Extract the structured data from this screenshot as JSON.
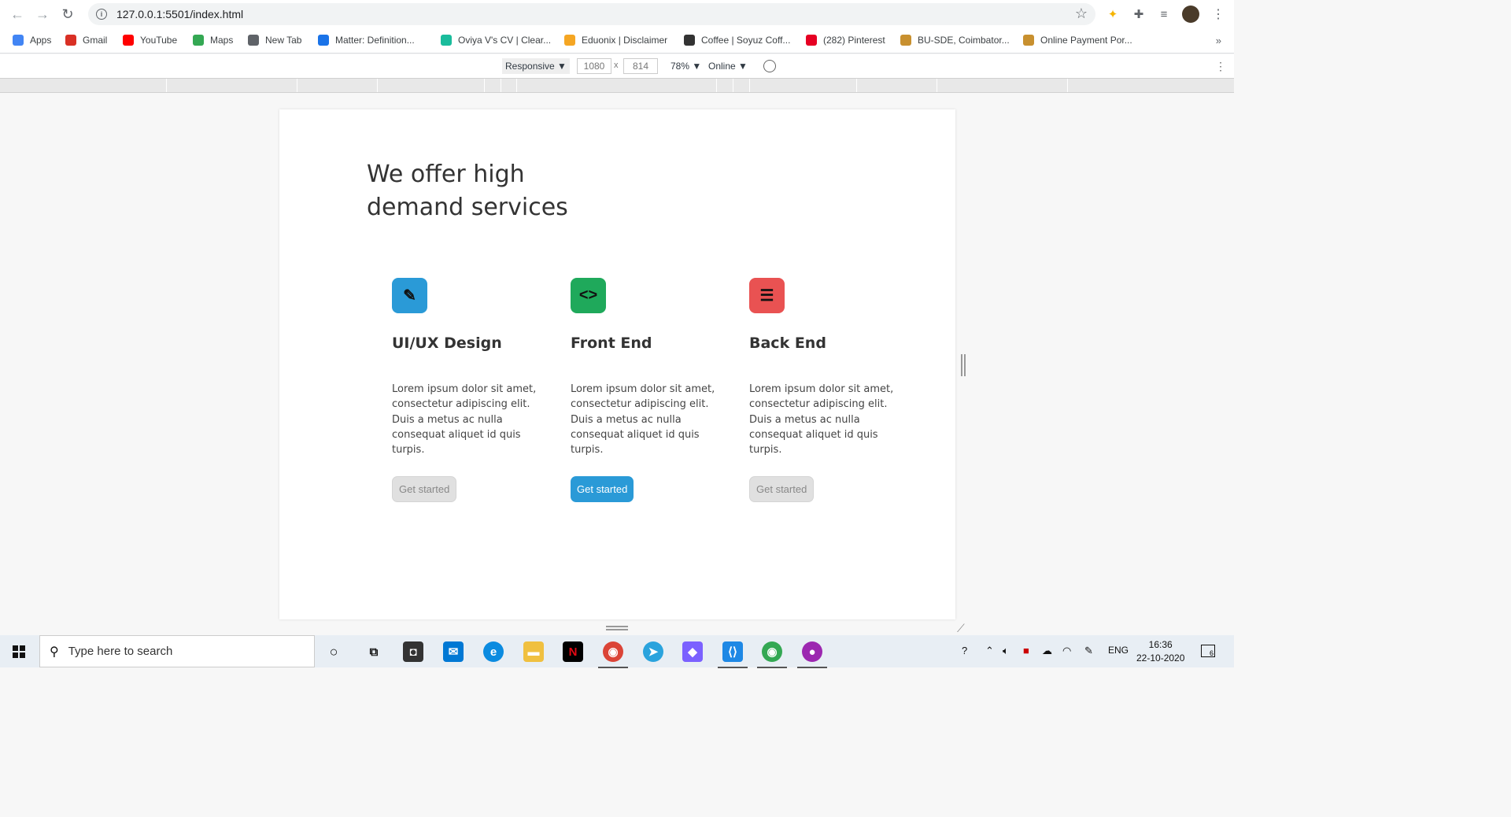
{
  "browser": {
    "url": "127.0.0.1:5501/index.html",
    "bookmarks": [
      {
        "label": "Apps",
        "color": "#4285f4"
      },
      {
        "label": "Gmail",
        "color": "#d93025"
      },
      {
        "label": "YouTube",
        "color": "#ff0000"
      },
      {
        "label": "Maps",
        "color": "#34a853"
      },
      {
        "label": "New Tab",
        "color": "#5f6368"
      },
      {
        "label": "Matter: Definition...",
        "color": "#1a73e8"
      },
      {
        "label": "Oviya V's CV | Clear...",
        "color": "#1abc9c"
      },
      {
        "label": "Eduonix | Disclaimer",
        "color": "#f5a623"
      },
      {
        "label": "Coffee | Soyuz Coff...",
        "color": "#333333"
      },
      {
        "label": "(282) Pinterest",
        "color": "#e60023"
      },
      {
        "label": "BU-SDE, Coimbator...",
        "color": "#c8902f"
      },
      {
        "label": "Online Payment Por...",
        "color": "#c8902f"
      }
    ],
    "bookmarks_more": "»"
  },
  "devtools": {
    "device": "Responsive ▼",
    "width": "1080",
    "height": "814",
    "times": "x",
    "zoom": "78% ▼",
    "network": "Online ▼"
  },
  "page": {
    "heading": "We offer high demand services",
    "services": [
      {
        "title": "UI/UX Design",
        "icon": "pencil-icon",
        "glyph": "✎",
        "color": "#2a9ad7",
        "description": "Lorem ipsum dolor sit amet, consectetur adipiscing elit. Duis a metus ac nulla consequat aliquet id quis turpis.",
        "button": "Get started",
        "active": false
      },
      {
        "title": "Front End",
        "icon": "code-icon",
        "glyph": "<>",
        "color": "#1fa95b",
        "description": "Lorem ipsum dolor sit amet, consectetur adipiscing elit. Duis a metus ac nulla consequat aliquet id quis turpis.",
        "button": "Get started",
        "active": true
      },
      {
        "title": "Back End",
        "icon": "server-icon",
        "glyph": "☰",
        "color": "#e95252",
        "description": "Lorem ipsum dolor sit amet, consectetur adipiscing elit. Duis a metus ac nulla consequat aliquet id quis turpis.",
        "button": "Get started",
        "active": false
      }
    ]
  },
  "taskbar": {
    "search_placeholder": "Type here to search",
    "language": "ENG",
    "time": "16:36",
    "date": "22-10-2020",
    "notifications": "6"
  }
}
